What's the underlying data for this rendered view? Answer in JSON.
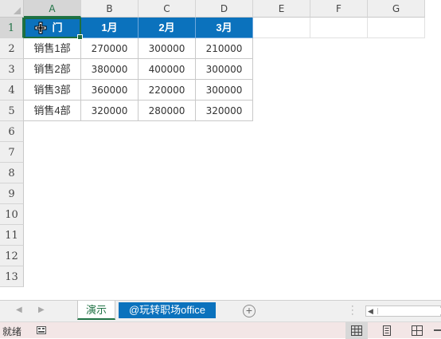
{
  "columns": [
    "A",
    "B",
    "C",
    "D",
    "E",
    "F",
    "G"
  ],
  "rows": [
    "1",
    "2",
    "3",
    "4",
    "5",
    "6",
    "7",
    "8",
    "9",
    "10",
    "11",
    "12",
    "13"
  ],
  "table": {
    "header": [
      "部门",
      "1月",
      "2月",
      "3月"
    ],
    "data": [
      [
        "销售1部",
        "270000",
        "300000",
        "210000"
      ],
      [
        "销售2部",
        "380000",
        "400000",
        "300000"
      ],
      [
        "销售3部",
        "360000",
        "220000",
        "300000"
      ],
      [
        "销售4部",
        "320000",
        "280000",
        "320000"
      ]
    ]
  },
  "header_cell_a1_visible": "门",
  "sheet_tabs": [
    {
      "label": "演示",
      "active": true
    },
    {
      "label": "@玩转职场office",
      "active": false
    }
  ],
  "status": {
    "ready": "就绪"
  },
  "icons": {
    "sheet_nav_prev": "chevron-left-icon",
    "sheet_nav_next": "chevron-right-icon",
    "new_sheet": "plus-circle-icon",
    "macro": "macro-record-icon",
    "normal_view": "grid-view-icon",
    "page_layout": "page-layout-icon",
    "page_break": "page-break-icon",
    "move_cursor": "move-cursor-icon"
  },
  "colors": {
    "header_fill": "#0b72bd",
    "accent": "#217346",
    "status_bg": "#f3e6e6"
  }
}
